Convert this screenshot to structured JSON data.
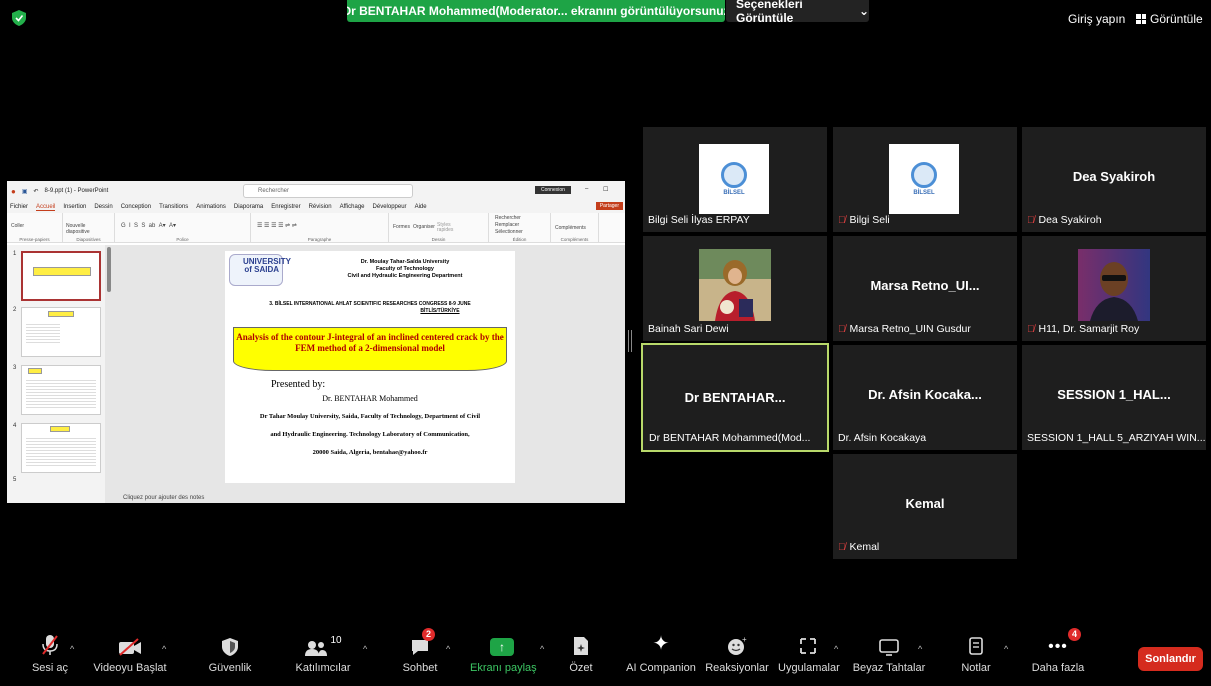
{
  "topbar": {
    "banner": "Dr BENTAHAR Mohammed(Moderator... ekranını görüntülüyorsunuz",
    "view_options": "Seçenekleri Görüntüle",
    "sign_in": "Giriş yapın",
    "view": "Görüntüle"
  },
  "shared_screen": {
    "window_title": "8-9.ppt (1) - PowerPoint",
    "search_placeholder": "Rechercher",
    "connexion": "Connexion",
    "partager": "Partager",
    "menu": [
      "Fichier",
      "Accueil",
      "Insertion",
      "Dessin",
      "Conception",
      "Transitions",
      "Animations",
      "Diaporama",
      "Enregistrer",
      "Révision",
      "Affichage",
      "Développeur",
      "Aide"
    ],
    "ribbon_groups": [
      "Presse-papiers",
      "Diapositives",
      "Police",
      "Paragraphe",
      "Dessin",
      "Édition",
      "Compléments"
    ],
    "ribbon_buttons": {
      "paste": "Coller",
      "new_slide": "Nouvelle diapositive",
      "shapes": "Formes",
      "arrange": "Organiser",
      "styles": "Styles rapides",
      "find": "Rechercher",
      "replace": "Remplacer",
      "select": "Sélectionner",
      "addins": "Compléments"
    },
    "thumb_numbers": [
      "1",
      "2",
      "3",
      "4",
      "5"
    ],
    "notes_placeholder": "Cliquez pour ajouter des notes",
    "slide": {
      "logo": "UNIVERSITY of SAIDA",
      "univ_line1": "Dr. Moulay Tahar-Saïda University",
      "univ_line2": "Faculty of Technology",
      "univ_line3": "Civil and Hydraulic Engineering Department",
      "congress_line1": "3. BİLSEL INTERNATIONAL AHLAT SCIENTIFIC RESEARCHES CONGRESS 8-9 JUNE",
      "congress_line2": "BİTLİS/TÜRKİYE",
      "title": "Analysis of the contour J-integral of an inclined centered crack by the FEM method of a 2-dimensional model",
      "presented_by": "Presented by:",
      "presenter": "Dr. BENTAHAR Mohammed",
      "aff1": "Dr Tahar Moulay University, Saida, Faculty of Technology, Department of Civil",
      "aff2": "and Hydraulic Engineering. Technology Laboratory of Communication,",
      "aff3": "20000 Saida, Algeria, bentahae@yahoo.fr"
    }
  },
  "participants": [
    {
      "name": "Bilgi Seli İlyas ERPAY",
      "muted": false,
      "display": "logo"
    },
    {
      "name": "Bilgi Seli",
      "muted": true,
      "display": "logo"
    },
    {
      "name": "Dea Syakiroh",
      "muted": true,
      "display": "text",
      "big": "Dea Syakiroh"
    },
    {
      "name": "Bainah Sari Dewi",
      "muted": false,
      "display": "photo"
    },
    {
      "name": "Marsa Retno_UIN Gusdur",
      "muted": true,
      "display": "text",
      "big": "Marsa Retno_UI..."
    },
    {
      "name": "H11, Dr. Samarjit Roy",
      "muted": true,
      "display": "photo"
    },
    {
      "name": "Dr BENTAHAR Mohammed(Mod...",
      "muted": false,
      "display": "text",
      "big": "Dr BENTAHAR...",
      "active": true
    },
    {
      "name": "Dr. Afsin Kocakaya",
      "muted": false,
      "display": "text",
      "big": "Dr. Afsin Kocaka..."
    },
    {
      "name": "SESSION 1_HALL 5_ARZIYAH WIN...",
      "muted": false,
      "display": "text",
      "big": "SESSION 1_HAL..."
    },
    {
      "name": "Kemal",
      "muted": true,
      "display": "text",
      "big": "Kemal"
    }
  ],
  "bilsel_logo_text": "BİLSEL",
  "toolbar": {
    "unmute": "Sesi aç",
    "start_video": "Videoyu Başlat",
    "security": "Güvenlik",
    "participants": "Katılımcılar",
    "participants_count": "10",
    "chat": "Sohbet",
    "chat_badge": "2",
    "share": "Ekranı paylaş",
    "summary": "Özet",
    "ai": "AI Companion",
    "reactions": "Reaksiyonlar",
    "apps": "Uygulamalar",
    "whiteboard": "Beyaz Tahtalar",
    "notes": "Notlar",
    "more": "Daha fazla",
    "more_badge": "4",
    "end": "Sonlandır"
  },
  "colors": {
    "share_green": "#1ea446",
    "end_red": "#d52b1e",
    "active_border": "#b8d96a",
    "tile_bg": "#1e1e1e"
  }
}
